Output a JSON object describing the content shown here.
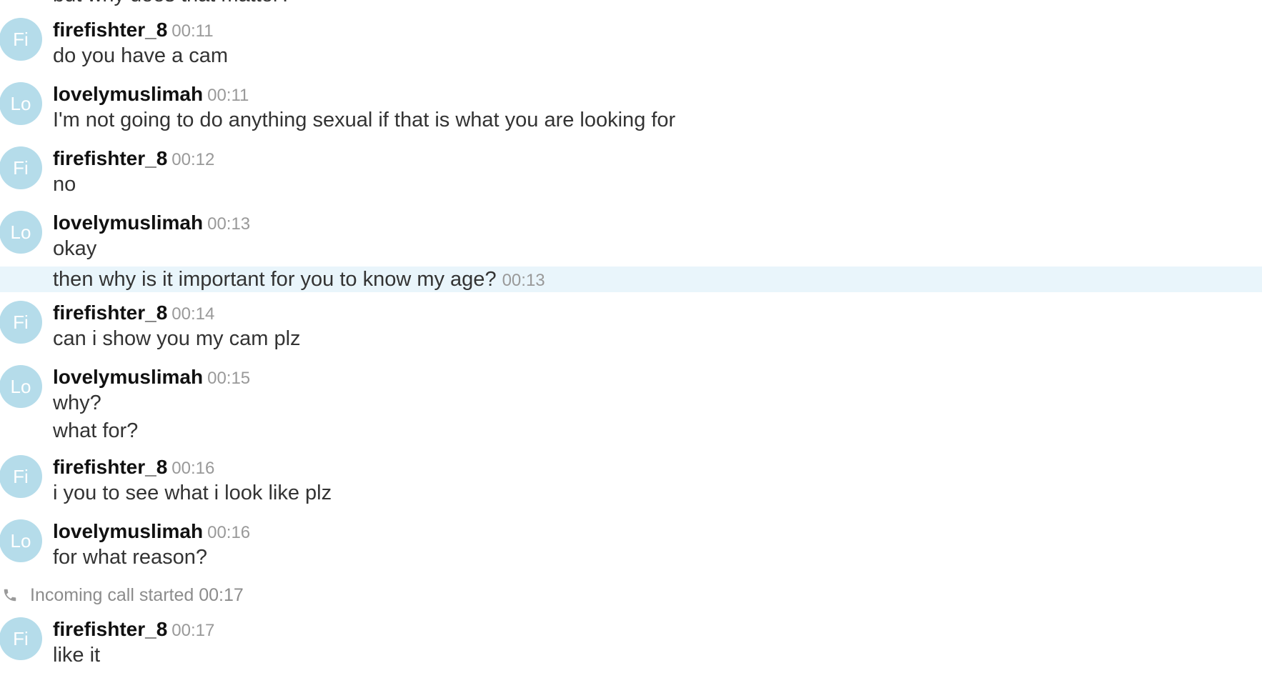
{
  "top_partial_text": "but why does that matter?",
  "messages": [
    {
      "avatar": "Fi",
      "sender": "firefishter_8",
      "time": "00:11",
      "lines": [
        "do you have a cam"
      ]
    },
    {
      "avatar": "Lo",
      "sender": "lovelymuslimah",
      "time": "00:11",
      "lines": [
        "I'm not going to do anything sexual if that is what you are looking for"
      ]
    },
    {
      "avatar": "Fi",
      "sender": "firefishter_8",
      "time": "00:12",
      "lines": [
        "no"
      ]
    },
    {
      "avatar": "Lo",
      "sender": "lovelymuslimah",
      "time": "00:13",
      "lines": [
        "okay"
      ]
    },
    {
      "avatar": "Fi",
      "sender": "firefishter_8",
      "time": "00:14",
      "lines": [
        "can i show you my cam plz"
      ]
    },
    {
      "avatar": "Lo",
      "sender": "lovelymuslimah",
      "time": "00:15",
      "lines": [
        "why?",
        "what for?"
      ]
    },
    {
      "avatar": "Fi",
      "sender": "firefishter_8",
      "time": "00:16",
      "lines": [
        "i you to see what i look like plz"
      ]
    },
    {
      "avatar": "Lo",
      "sender": "lovelymuslimah",
      "time": "00:16",
      "lines": [
        "for what reason?"
      ]
    },
    {
      "avatar": "Fi",
      "sender": "firefishter_8",
      "time": "00:17",
      "lines": [
        "like it"
      ]
    }
  ],
  "highlighted_message": {
    "text": "then why is it important for you to know my age?",
    "time": "00:13"
  },
  "call_event": {
    "icon": "phone-icon",
    "text": "Incoming call started 00:17"
  },
  "colors": {
    "avatar_bg": "#b5dcea",
    "highlight_bg": "#e9f5fb",
    "sender": "#111111",
    "timestamp": "#999999",
    "body_text": "#333333"
  }
}
